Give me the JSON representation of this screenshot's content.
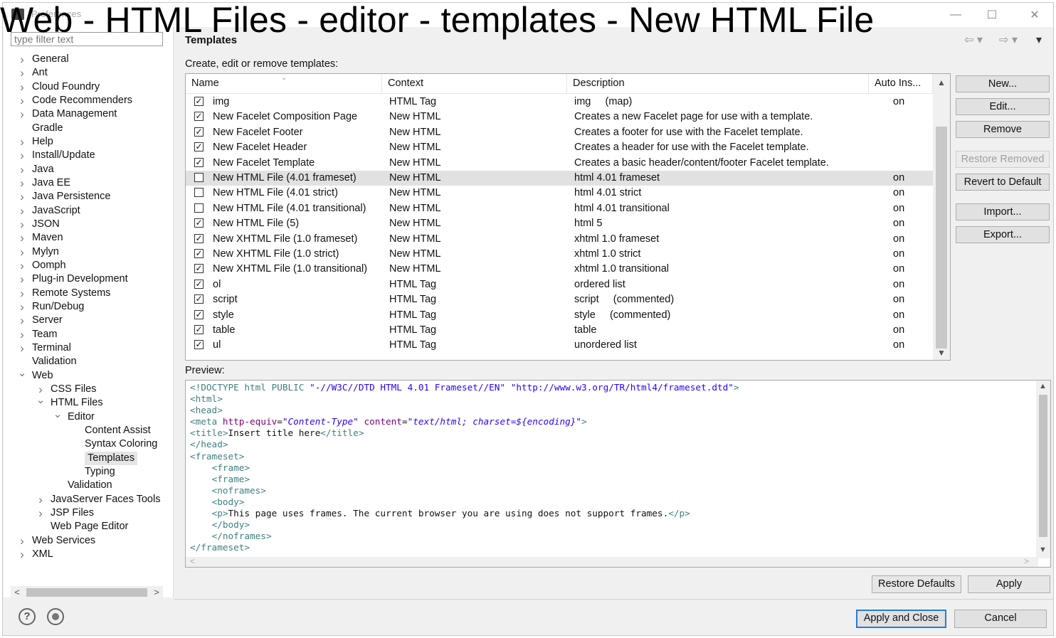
{
  "window": {
    "title": "Preferences",
    "overlay_title": "Web - HTML Files - editor - templates - New HTML File",
    "controls": [
      "—",
      "☐",
      "✕"
    ]
  },
  "sidebar": {
    "filter_placeholder": "type filter text",
    "items": [
      {
        "label": "General",
        "level": 0,
        "twisty": ">"
      },
      {
        "label": "Ant",
        "level": 0,
        "twisty": ">"
      },
      {
        "label": "Cloud Foundry",
        "level": 0,
        "twisty": ">"
      },
      {
        "label": "Code Recommenders",
        "level": 0,
        "twisty": ">"
      },
      {
        "label": "Data Management",
        "level": 0,
        "twisty": ">"
      },
      {
        "label": "Gradle",
        "level": 0,
        "twisty": ""
      },
      {
        "label": "Help",
        "level": 0,
        "twisty": ">"
      },
      {
        "label": "Install/Update",
        "level": 0,
        "twisty": ">"
      },
      {
        "label": "Java",
        "level": 0,
        "twisty": ">"
      },
      {
        "label": "Java EE",
        "level": 0,
        "twisty": ">"
      },
      {
        "label": "Java Persistence",
        "level": 0,
        "twisty": ">"
      },
      {
        "label": "JavaScript",
        "level": 0,
        "twisty": ">"
      },
      {
        "label": "JSON",
        "level": 0,
        "twisty": ">"
      },
      {
        "label": "Maven",
        "level": 0,
        "twisty": ">"
      },
      {
        "label": "Mylyn",
        "level": 0,
        "twisty": ">"
      },
      {
        "label": "Oomph",
        "level": 0,
        "twisty": ">"
      },
      {
        "label": "Plug-in Development",
        "level": 0,
        "twisty": ">"
      },
      {
        "label": "Remote Systems",
        "level": 0,
        "twisty": ">"
      },
      {
        "label": "Run/Debug",
        "level": 0,
        "twisty": ">"
      },
      {
        "label": "Server",
        "level": 0,
        "twisty": ">"
      },
      {
        "label": "Team",
        "level": 0,
        "twisty": ">"
      },
      {
        "label": "Terminal",
        "level": 0,
        "twisty": ">"
      },
      {
        "label": "Validation",
        "level": 0,
        "twisty": ""
      },
      {
        "label": "Web",
        "level": 0,
        "twisty": "v"
      },
      {
        "label": "CSS Files",
        "level": 1,
        "twisty": ">"
      },
      {
        "label": "HTML Files",
        "level": 1,
        "twisty": "v"
      },
      {
        "label": "Editor",
        "level": 2,
        "twisty": "v"
      },
      {
        "label": "Content Assist",
        "level": 3,
        "twisty": ""
      },
      {
        "label": "Syntax Coloring",
        "level": 3,
        "twisty": ""
      },
      {
        "label": "Templates",
        "level": 3,
        "twisty": "",
        "selected": true
      },
      {
        "label": "Typing",
        "level": 3,
        "twisty": ""
      },
      {
        "label": "Validation",
        "level": 2,
        "twisty": ""
      },
      {
        "label": "JavaServer Faces Tools",
        "level": 1,
        "twisty": ">"
      },
      {
        "label": "JSP Files",
        "level": 1,
        "twisty": ">"
      },
      {
        "label": "Web Page Editor",
        "level": 1,
        "twisty": ""
      },
      {
        "label": "Web Services",
        "level": 0,
        "twisty": ">"
      },
      {
        "label": "XML",
        "level": 0,
        "twisty": ">"
      }
    ]
  },
  "main": {
    "page_title": "Templates",
    "subtitle": "Create, edit or remove templates:",
    "columns": [
      "Name",
      "Context",
      "Description",
      "Auto Ins..."
    ],
    "rows": [
      {
        "checked": true,
        "name": "img",
        "context": "HTML Tag",
        "description": "img     (map)",
        "auto": "on"
      },
      {
        "checked": true,
        "name": "New Facelet Composition Page",
        "context": "New HTML",
        "description": "Creates a new Facelet page for use with a template.",
        "auto": ""
      },
      {
        "checked": true,
        "name": "New Facelet Footer",
        "context": "New HTML",
        "description": "Creates a footer for use with the Facelet template.",
        "auto": ""
      },
      {
        "checked": true,
        "name": "New Facelet Header",
        "context": "New HTML",
        "description": "Creates a header for use with the Facelet template.",
        "auto": ""
      },
      {
        "checked": true,
        "name": "New Facelet Template",
        "context": "New HTML",
        "description": "Creates a basic header/content/footer Facelet template.",
        "auto": ""
      },
      {
        "checked": false,
        "name": "New HTML File (4.01 frameset)",
        "context": "New HTML",
        "description": "html 4.01 frameset",
        "auto": "on",
        "selected": true
      },
      {
        "checked": false,
        "name": "New HTML File (4.01 strict)",
        "context": "New HTML",
        "description": "html 4.01 strict",
        "auto": "on"
      },
      {
        "checked": false,
        "name": "New HTML File (4.01 transitional)",
        "context": "New HTML",
        "description": "html 4.01 transitional",
        "auto": "on"
      },
      {
        "checked": true,
        "name": "New HTML File (5)",
        "context": "New HTML",
        "description": "html 5",
        "auto": "on"
      },
      {
        "checked": true,
        "name": "New XHTML File (1.0 frameset)",
        "context": "New HTML",
        "description": "xhtml 1.0 frameset",
        "auto": "on"
      },
      {
        "checked": true,
        "name": "New XHTML File (1.0 strict)",
        "context": "New HTML",
        "description": "xhtml 1.0 strict",
        "auto": "on"
      },
      {
        "checked": true,
        "name": "New XHTML File (1.0 transitional)",
        "context": "New HTML",
        "description": "xhtml 1.0 transitional",
        "auto": "on"
      },
      {
        "checked": true,
        "name": "ol",
        "context": "HTML Tag",
        "description": "ordered list",
        "auto": "on"
      },
      {
        "checked": true,
        "name": "script",
        "context": "HTML Tag",
        "description": "script     (commented)",
        "auto": "on"
      },
      {
        "checked": true,
        "name": "style",
        "context": "HTML Tag",
        "description": "style     (commented)",
        "auto": "on"
      },
      {
        "checked": true,
        "name": "table",
        "context": "HTML Tag",
        "description": "table",
        "auto": "on"
      },
      {
        "checked": true,
        "name": "ul",
        "context": "HTML Tag",
        "description": "unordered list",
        "auto": "on"
      }
    ],
    "buttons": {
      "new": "New...",
      "edit": "Edit...",
      "remove": "Remove",
      "restore_removed": "Restore Removed",
      "revert": "Revert to Default",
      "import": "Import...",
      "export": "Export..."
    },
    "preview_label": "Preview:",
    "preview_lines": [
      [
        [
          "tag",
          "<!DOCTYPE "
        ],
        [
          "tag",
          "html"
        ],
        [
          "plain",
          " "
        ],
        [
          "tag",
          "PUBLIC "
        ],
        [
          "val2",
          "\"-//W3C//DTD HTML 4.01 Frameset//EN\""
        ],
        [
          "plain",
          " "
        ],
        [
          "val2",
          "\"http://www.w3.org/TR/html4/frameset.dtd\""
        ],
        [
          "tag",
          ">"
        ]
      ],
      [
        [
          "tag",
          "<html>"
        ]
      ],
      [
        [
          "tag",
          "<head>"
        ]
      ],
      [
        [
          "tag",
          "<meta "
        ],
        [
          "attr",
          "http-equiv"
        ],
        [
          "plain",
          "="
        ],
        [
          "val",
          "\"Content-Type\""
        ],
        [
          "plain",
          " "
        ],
        [
          "attr",
          "content"
        ],
        [
          "plain",
          "="
        ],
        [
          "val",
          "\"text/html; charset=${encoding}\""
        ],
        [
          "tag",
          ">"
        ]
      ],
      [
        [
          "tag",
          "<title>"
        ],
        [
          "plain",
          "Insert title here"
        ],
        [
          "tag",
          "</title>"
        ]
      ],
      [
        [
          "tag",
          "</head>"
        ]
      ],
      [
        [
          "tag",
          "<frameset>"
        ]
      ],
      [
        [
          "plain",
          "    "
        ],
        [
          "tag",
          "<frame>"
        ]
      ],
      [
        [
          "plain",
          "    "
        ],
        [
          "tag",
          "<frame>"
        ]
      ],
      [
        [
          "plain",
          "    "
        ],
        [
          "tag",
          "<noframes>"
        ]
      ],
      [
        [
          "plain",
          "    "
        ],
        [
          "tag",
          "<body>"
        ]
      ],
      [
        [
          "plain",
          "    "
        ],
        [
          "tag",
          "<p>"
        ],
        [
          "plain",
          "This page uses frames. The current browser you are using does not support frames."
        ],
        [
          "tag",
          "</p>"
        ]
      ],
      [
        [
          "plain",
          "    "
        ],
        [
          "tag",
          "</body>"
        ]
      ],
      [
        [
          "plain",
          "    "
        ],
        [
          "tag",
          "</noframes>"
        ]
      ],
      [
        [
          "tag",
          "</frameset>"
        ]
      ]
    ],
    "restore_defaults": "Restore Defaults",
    "apply": "Apply"
  },
  "footer": {
    "help_icon": "?",
    "apply_close": "Apply and Close",
    "cancel": "Cancel"
  }
}
